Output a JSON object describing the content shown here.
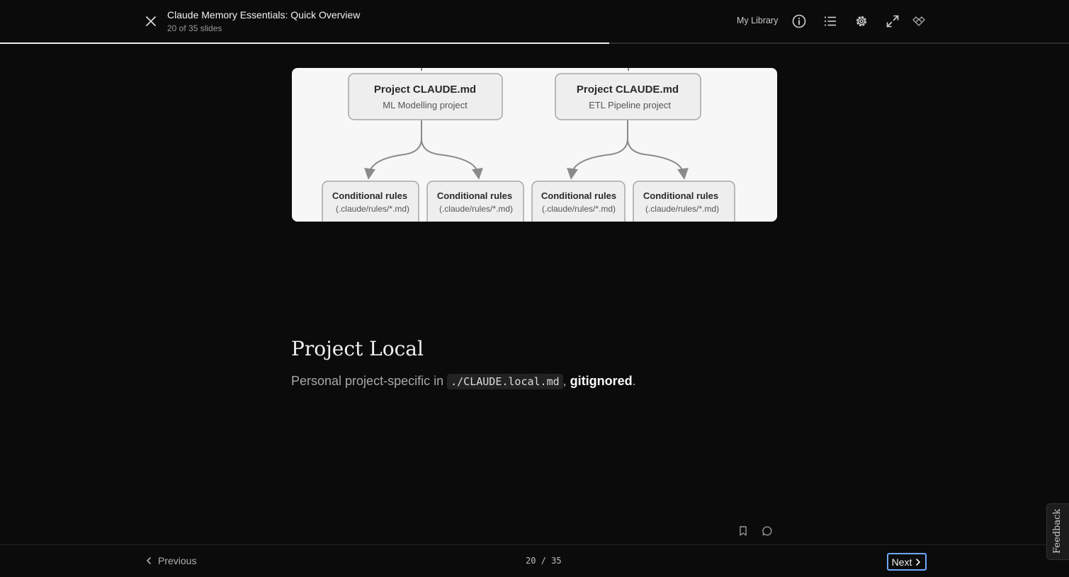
{
  "header": {
    "title": "Claude Memory Essentials: Quick Overview",
    "subtitle": "20 of 35 slides",
    "library_label": "My Library",
    "progress_fraction": 0.57,
    "icons": [
      "close-icon",
      "info-icon",
      "list-icon",
      "settings-icon",
      "expand-icon",
      "logo-icon"
    ]
  },
  "diagram": {
    "projects": [
      {
        "title": "Project CLAUDE.md",
        "subtitle": "ML Modelling project"
      },
      {
        "title": "Project CLAUDE.md",
        "subtitle": "ETL Pipeline project"
      }
    ],
    "rules": [
      {
        "title": "Conditional rules",
        "path": "(.claude/rules/*.md)"
      },
      {
        "title": "Conditional rules",
        "path": "(.claude/rules/*.md)"
      },
      {
        "title": "Conditional rules",
        "path": "(.claude/rules/*.md)"
      },
      {
        "title": "Conditional rules",
        "path": "(.claude/rules/*.md)"
      }
    ]
  },
  "slide": {
    "heading": "Project Local",
    "body_prefix": "Personal project-specific in ",
    "code": "./CLAUDE.local.md",
    "comma": ", ",
    "strong": "gitignored",
    "suffix": "."
  },
  "footer": {
    "previous_label": "Previous",
    "counter": "20 / 35",
    "next_label": "Next",
    "feedback_label": "Feedback"
  },
  "colors": {
    "accent": "#6ea8ff",
    "background": "#0b0b0b"
  }
}
